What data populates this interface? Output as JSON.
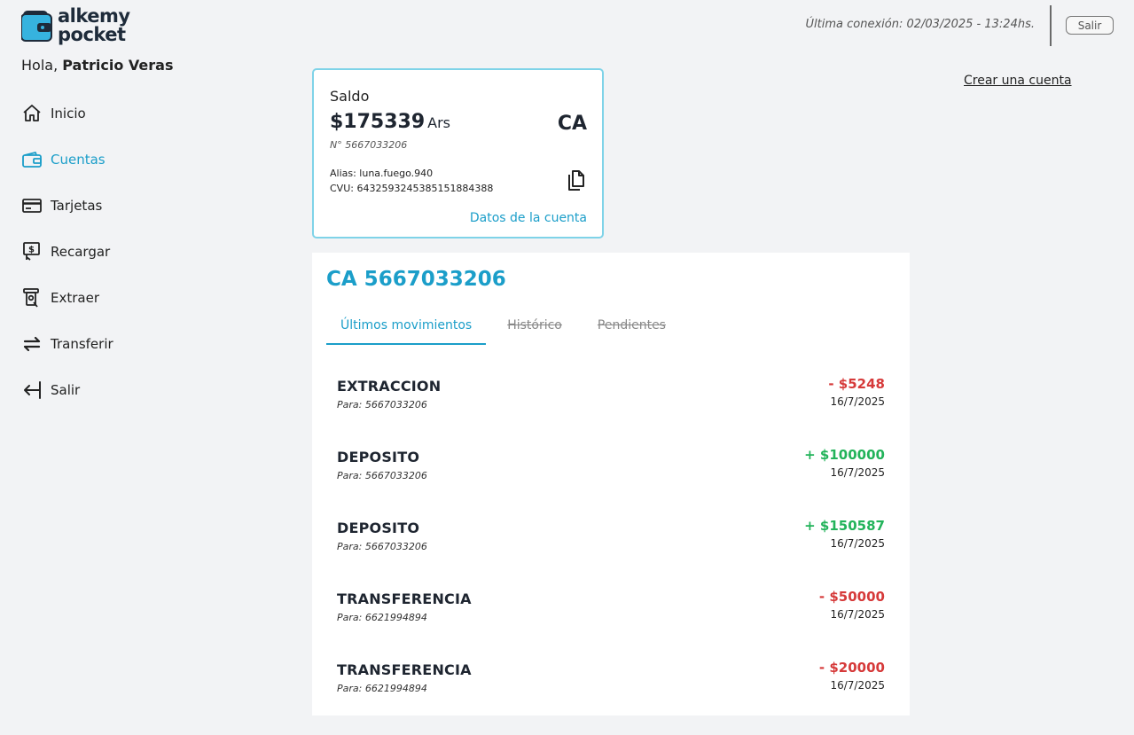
{
  "brand": {
    "line1": "alkemy",
    "line2": "pocket"
  },
  "greeting": {
    "prefix": "Hola,",
    "name": "Patricio Veras"
  },
  "nav": [
    {
      "label": "Inicio",
      "icon": "home-icon",
      "active": false
    },
    {
      "label": "Cuentas",
      "icon": "wallet-icon",
      "active": true
    },
    {
      "label": "Tarjetas",
      "icon": "credit-card-icon",
      "active": false
    },
    {
      "label": "Recargar",
      "icon": "recharge-icon",
      "active": false
    },
    {
      "label": "Extraer",
      "icon": "atm-withdraw-icon",
      "active": false
    },
    {
      "label": "Transferir",
      "icon": "transfer-icon",
      "active": false
    },
    {
      "label": "Salir",
      "icon": "logout-arrow-icon",
      "active": false
    }
  ],
  "header": {
    "last_login": "Última conexión: 02/03/2025 - 13:24hs.",
    "logout_label": "Salir"
  },
  "create_account_label": "Crear una cuenta",
  "balance_card": {
    "label": "Saldo",
    "amount": "$175339",
    "currency": "Ars",
    "type": "CA",
    "number": "N° 5667033206",
    "alias": "Alias: luna.fuego.940",
    "cvu": "CVU: 6432593245385151884388",
    "details_link": "Datos de la cuenta"
  },
  "panel": {
    "title": "CA 5667033206",
    "tabs": [
      {
        "label": "Últimos movimientos",
        "state": "active"
      },
      {
        "label": "Histórico",
        "state": "disabled"
      },
      {
        "label": "Pendientes",
        "state": "disabled"
      }
    ],
    "movements": [
      {
        "type": "EXTRACCION",
        "dest": "Para: 5667033206",
        "amount": "- $5248",
        "sign": "neg",
        "date": "16/7/2025"
      },
      {
        "type": "DEPOSITO",
        "dest": "Para: 5667033206",
        "amount": "+ $100000",
        "sign": "pos",
        "date": "16/7/2025"
      },
      {
        "type": "DEPOSITO",
        "dest": "Para: 5667033206",
        "amount": "+ $150587",
        "sign": "pos",
        "date": "16/7/2025"
      },
      {
        "type": "TRANSFERENCIA",
        "dest": "Para: 6621994894",
        "amount": "- $50000",
        "sign": "neg",
        "date": "16/7/2025"
      },
      {
        "type": "TRANSFERENCIA",
        "dest": "Para: 6621994894",
        "amount": "- $20000",
        "sign": "neg",
        "date": "16/7/2025"
      }
    ]
  },
  "colors": {
    "accent": "#1b9ec9",
    "positive": "#22b35a",
    "negative": "#d63a3a",
    "card_border": "#7fd3e8"
  }
}
